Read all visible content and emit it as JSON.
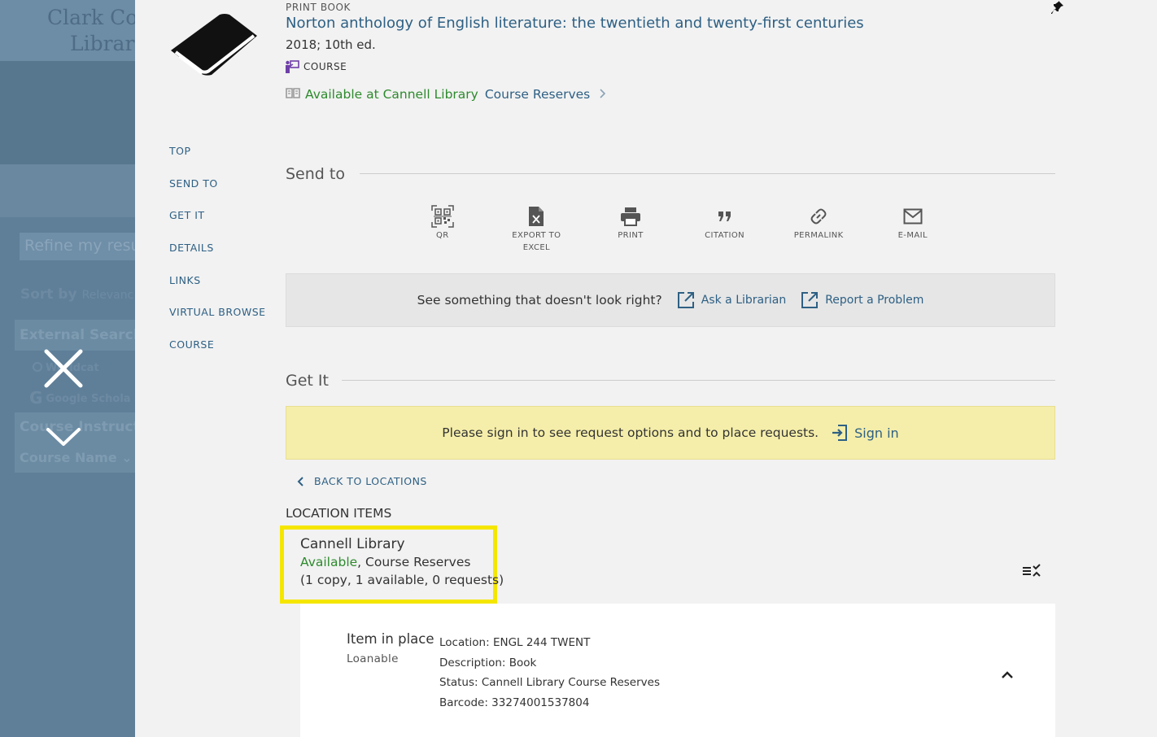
{
  "background": {
    "header_line1": "Clark Co",
    "header_line2": "Librari",
    "refine_placeholder": "Refine my resu",
    "sort_by_label": "Sort by",
    "sort_by_value": "Relevanc",
    "external_search": "External Search",
    "ext_item_1": "Worldcat",
    "ext_item_2": "Google Schola",
    "course_instructor": "Course Instructo",
    "course_name": "Course Name"
  },
  "record": {
    "type": "PRINT BOOK",
    "title": "Norton anthology of English literature: the twentieth and twenty-first centuries",
    "edition": "2018; 10th ed.",
    "course_tag": "COURSE",
    "availability_status": "Available at Cannell Library",
    "availability_location": "Course Reserves"
  },
  "sidenav": {
    "items": [
      "TOP",
      "SEND TO",
      "GET IT",
      "DETAILS",
      "LINKS",
      "VIRTUAL BROWSE",
      "COURSE"
    ]
  },
  "send_to": {
    "title": "Send to",
    "actions": [
      {
        "label": "QR",
        "icon": "qr-code-icon"
      },
      {
        "label": "EXPORT TO EXCEL",
        "icon": "excel-icon"
      },
      {
        "label": "PRINT",
        "icon": "printer-icon"
      },
      {
        "label": "CITATION",
        "icon": "quote-icon"
      },
      {
        "label": "PERMALINK",
        "icon": "link-icon"
      },
      {
        "label": "E-MAIL",
        "icon": "envelope-icon"
      }
    ]
  },
  "feedback": {
    "text": "See something that doesn't look right?",
    "ask_librarian": "Ask a Librarian",
    "report_problem": "Report a Problem"
  },
  "get_it": {
    "title": "Get It",
    "signin_text": "Please sign in to see request options and to place requests.",
    "signin_link": "Sign in",
    "back_to_locations": "BACK TO LOCATIONS",
    "location_items_title": "LOCATION ITEMS",
    "location": {
      "name": "Cannell Library",
      "status": "Available",
      "sublocation": ", Course Reserves",
      "copies": "(1 copy, 1 available, 0 requests)"
    },
    "item": {
      "status": "Item in place",
      "policy": "Loanable",
      "location": "Location: ENGL 244 TWENT",
      "description": "Description: Book",
      "item_status": "Status: Cannell Library Course Reserves",
      "barcode": "Barcode: 33274001537804"
    }
  },
  "colors": {
    "link": "#2e6084",
    "available": "#2d8a2d",
    "highlight": "#f5e600",
    "signin_bg": "#f5eeaa"
  }
}
